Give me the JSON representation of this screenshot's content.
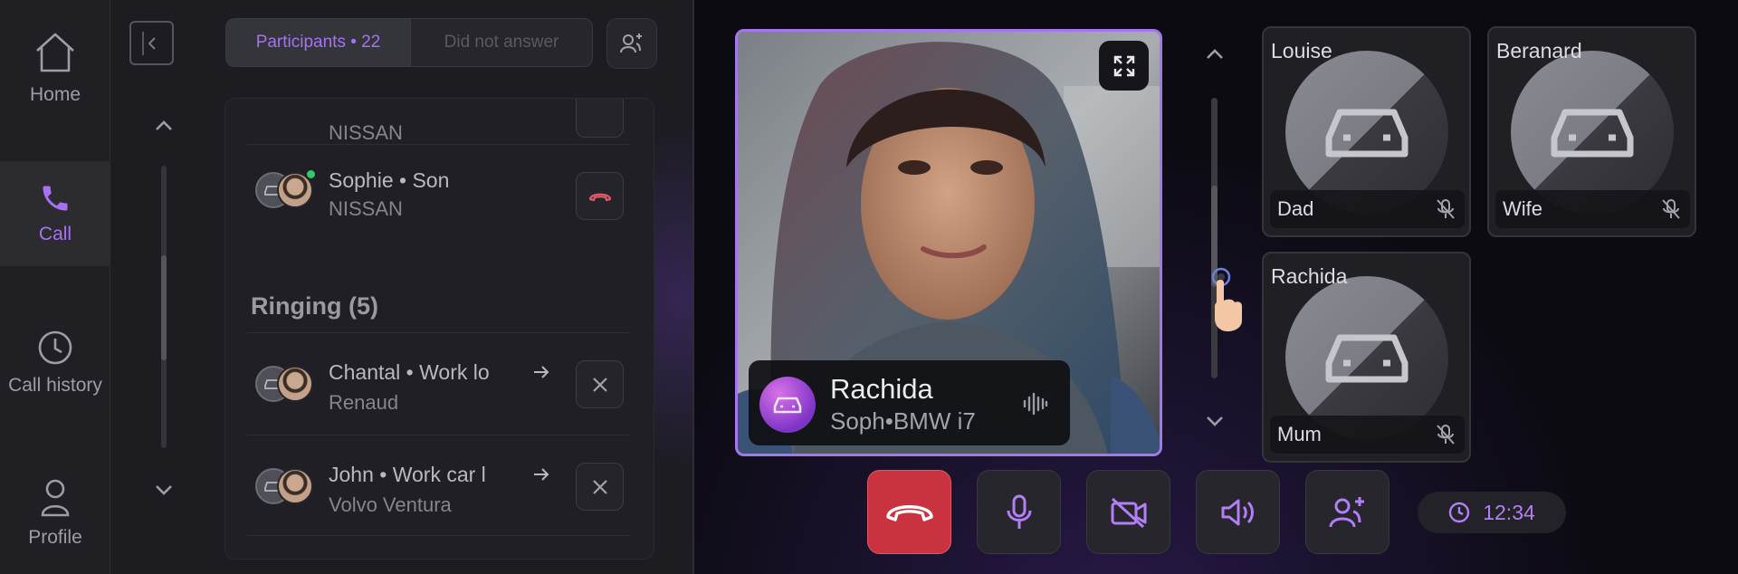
{
  "nav": {
    "items": [
      {
        "label": "Home",
        "icon": "home-icon"
      },
      {
        "label": "Call",
        "icon": "phone-icon",
        "active": true
      },
      {
        "label": "Call history",
        "icon": "clock-icon"
      },
      {
        "label": "Profile",
        "icon": "user-icon"
      }
    ]
  },
  "panel": {
    "tabs": {
      "participants": "Participants • 22",
      "did_not_answer": "Did not answer"
    },
    "partial_row_sub": "NISSAN",
    "rows": [
      {
        "name": "Sophie • Son",
        "sub": "NISSAN",
        "action": "hang-up"
      },
      {
        "name": "Chantal  • Work lo",
        "sub": "Renaud",
        "action": "dismiss"
      },
      {
        "name": "John  • Work car l",
        "sub": "Volvo Ventura",
        "action": "dismiss"
      }
    ],
    "section_ringing": "Ringing  (5)"
  },
  "video": {
    "caller_name": "Rachida",
    "caller_sub": "Soph•BMW i7"
  },
  "tiles": [
    {
      "name": "Louise",
      "role": "Dad"
    },
    {
      "name": "Beranard",
      "role": "Wife"
    },
    {
      "name": "Rachida",
      "role": "Mum"
    }
  ],
  "timer": "12:34",
  "colors": {
    "accent": "#a772f2",
    "end_call": "#c9333f",
    "online": "#2fcb6d"
  }
}
